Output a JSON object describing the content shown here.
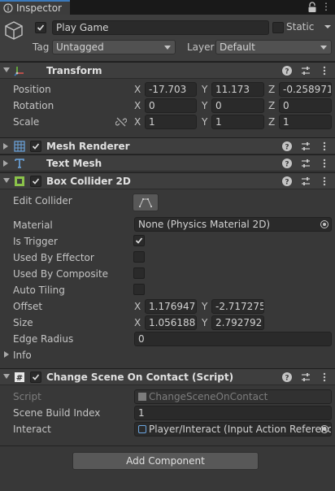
{
  "tab": {
    "label": "Inspector",
    "icon": "info-icon"
  },
  "header": {
    "name": "Play Game",
    "static_label": "Static",
    "tag_label": "Tag",
    "tag_value": "Untagged",
    "layer_label": "Layer",
    "layer_value": "Default"
  },
  "transform": {
    "title": "Transform",
    "rows": [
      {
        "label": "Position",
        "x": "-17.703",
        "y": "11.173",
        "z": "-0.258971"
      },
      {
        "label": "Rotation",
        "x": "0",
        "y": "0",
        "z": "0"
      },
      {
        "label": "Scale",
        "x": "1",
        "y": "1",
        "z": "1"
      }
    ],
    "axes": {
      "x": "X",
      "y": "Y",
      "z": "Z"
    }
  },
  "mesh_renderer": {
    "title": "Mesh Renderer"
  },
  "text_mesh": {
    "title": "Text Mesh"
  },
  "box_collider": {
    "title": "Box Collider 2D",
    "edit_collider": "Edit Collider",
    "material_label": "Material",
    "material_value": "None (Physics Material 2D)",
    "is_trigger": "Is Trigger",
    "used_by_effector": "Used By Effector",
    "used_by_composite": "Used By Composite",
    "auto_tiling": "Auto Tiling",
    "offset_label": "Offset",
    "offset_x": "1.176947",
    "offset_y": "-2.717275",
    "size_label": "Size",
    "size_x": "1.056188",
    "size_y": "2.792792",
    "edge_radius_label": "Edge Radius",
    "edge_radius_value": "0",
    "info_label": "Info"
  },
  "change_scene": {
    "title": "Change Scene On Contact (Script)",
    "script_label": "Script",
    "script_value": "ChangeSceneOnContact",
    "scene_index_label": "Scene Build Index",
    "scene_index_value": "1",
    "interact_label": "Interact",
    "interact_value": "Player/Interact (Input Action Reference)"
  },
  "add_component": "Add Component",
  "colors": {
    "background": "#383838",
    "field": "#2a2a2a",
    "accent": "#3a79bb"
  }
}
